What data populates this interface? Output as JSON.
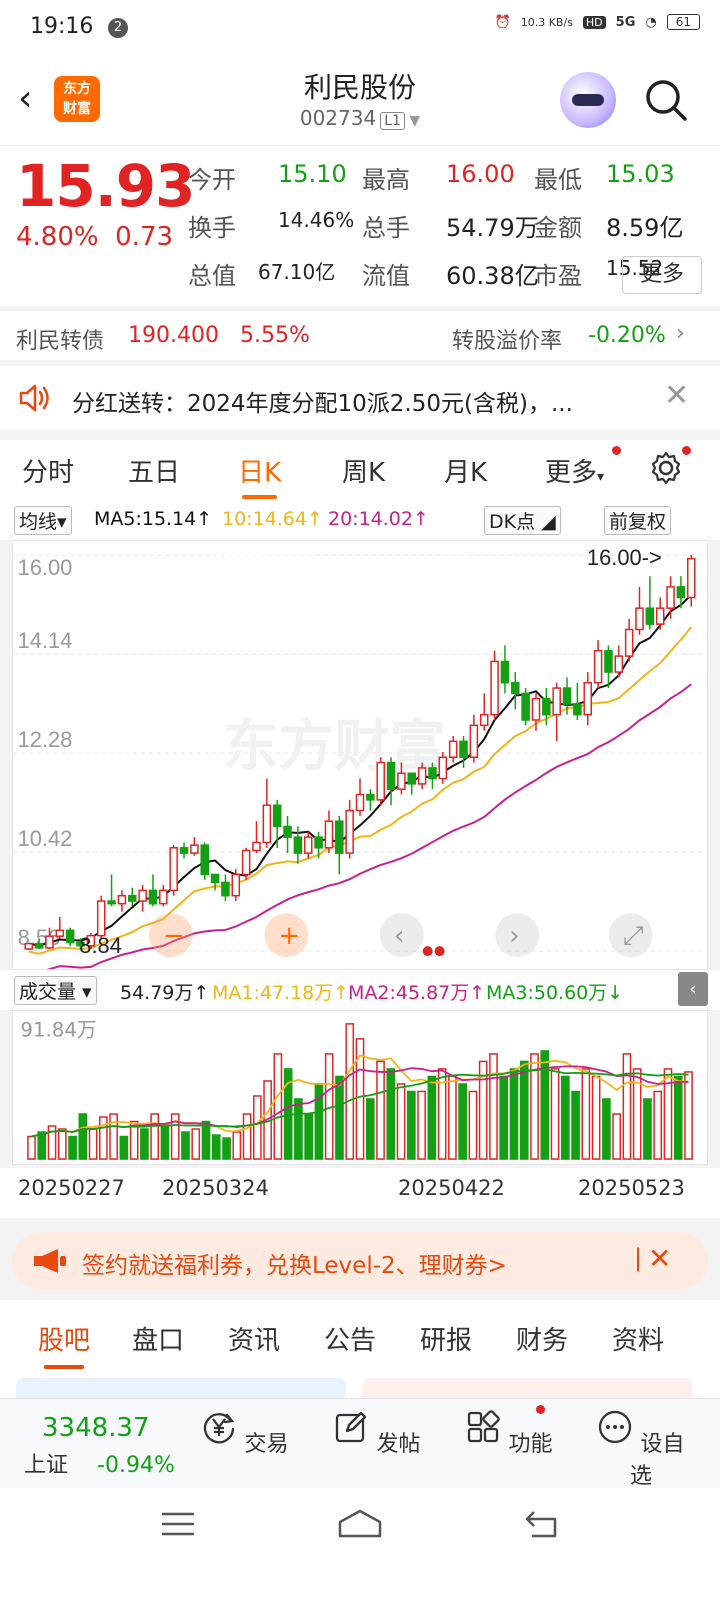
{
  "status": {
    "time": "19:16",
    "badge": "2",
    "net": "10.3 KB/s",
    "hd": "HD",
    "signal": "5G",
    "battery": "61"
  },
  "header": {
    "title": "利民股份",
    "code": "002734",
    "level": "L1",
    "logo": "东方财富"
  },
  "quote": {
    "price": "15.93",
    "pct": "4.80%",
    "change": "0.73",
    "rows": [
      [
        {
          "label": "今开",
          "value": "15.10",
          "color": "green"
        },
        {
          "label": "最高",
          "value": "16.00",
          "color": "red"
        },
        {
          "label": "最低",
          "value": "15.03",
          "color": "green"
        }
      ],
      [
        {
          "label": "换手",
          "value": "14.46%",
          "color": "dark"
        },
        {
          "label": "总手",
          "value": "54.79万",
          "color": "dark"
        },
        {
          "label": "金额",
          "value": "8.59亿",
          "color": "dark"
        }
      ],
      [
        {
          "label": "总值",
          "value": "67.10亿",
          "color": "dark"
        },
        {
          "label": "流值",
          "value": "60.38亿",
          "color": "dark"
        },
        {
          "label": "市盈",
          "value": "15.52",
          "color": "dark"
        }
      ]
    ],
    "more": "更多"
  },
  "cbond": {
    "name": "利民转债",
    "price": "190.400",
    "pct": "5.55%",
    "premium_label": "转股溢价率",
    "premium": "-0.20%"
  },
  "notice": {
    "text": "分红送转：2024年度分配10派2.50元(含税)，..."
  },
  "chart_tabs": [
    "分时",
    "五日",
    "日K",
    "周K",
    "月K",
    "更多"
  ],
  "ma_bar": {
    "select": "均线",
    "ma5": "MA5:15.14",
    "ma10": "10:14.64",
    "ma20": "20:14.02",
    "dk": "DK点",
    "adjust": "前复权"
  },
  "vol_bar": {
    "select": "成交量",
    "vol": "54.79万",
    "ma1": "MA1:47.18万",
    "ma2": "MA2:45.87万",
    "ma3": "MA3:50.60万"
  },
  "colors": {
    "up": "#e02424",
    "down": "#14a014",
    "ma5": "#111111",
    "ma10": "#f2b418",
    "ma20": "#c8208c",
    "accent": "#ff6a00"
  },
  "chart_data": {
    "type": "candlestick",
    "y_ticks": [
      "16.00",
      "14.14",
      "12.28",
      "10.42",
      "8.56"
    ],
    "ylim": [
      8.56,
      16.0
    ],
    "high_label": "16.00->",
    "low_label": "8.84",
    "candles": [
      [
        8.6,
        8.7,
        8.7,
        8.58
      ],
      [
        8.7,
        8.62,
        8.8,
        8.6
      ],
      [
        8.62,
        8.84,
        9.0,
        8.6
      ],
      [
        8.84,
        8.95,
        9.2,
        8.8
      ],
      [
        8.95,
        8.72,
        9.0,
        8.65
      ],
      [
        8.72,
        8.66,
        8.8,
        8.6
      ],
      [
        8.66,
        8.85,
        8.9,
        8.6
      ],
      [
        8.85,
        9.5,
        9.6,
        8.8
      ],
      [
        9.5,
        9.45,
        10.0,
        9.4
      ],
      [
        9.45,
        9.6,
        9.7,
        9.3
      ],
      [
        9.6,
        9.5,
        9.75,
        9.4
      ],
      [
        9.5,
        9.7,
        9.8,
        9.3
      ],
      [
        9.7,
        9.45,
        10.0,
        9.4
      ],
      [
        9.45,
        9.7,
        9.8,
        9.4
      ],
      [
        9.7,
        10.5,
        10.55,
        9.6
      ],
      [
        10.5,
        10.4,
        10.6,
        10.3
      ],
      [
        10.4,
        10.55,
        10.7,
        10.35
      ],
      [
        10.55,
        10.0,
        10.6,
        9.9
      ],
      [
        10.0,
        9.85,
        10.0,
        9.7
      ],
      [
        9.85,
        9.6,
        10.0,
        9.5
      ],
      [
        9.6,
        10.0,
        10.1,
        9.5
      ],
      [
        10.0,
        10.45,
        10.5,
        9.9
      ],
      [
        10.45,
        10.6,
        11.0,
        10.4
      ],
      [
        10.6,
        11.3,
        11.8,
        10.5
      ],
      [
        11.3,
        10.9,
        11.4,
        10.5
      ],
      [
        10.9,
        10.7,
        11.1,
        10.4
      ],
      [
        10.7,
        10.4,
        10.9,
        10.2
      ],
      [
        10.4,
        10.7,
        10.8,
        10.3
      ],
      [
        10.7,
        10.5,
        10.8,
        10.3
      ],
      [
        10.5,
        11.0,
        11.2,
        10.4
      ],
      [
        11.0,
        10.4,
        11.1,
        10.0
      ],
      [
        10.4,
        11.2,
        11.4,
        10.3
      ],
      [
        11.2,
        11.5,
        11.8,
        11.1
      ],
      [
        11.5,
        11.4,
        11.6,
        11.2
      ],
      [
        11.4,
        12.1,
        12.2,
        11.3
      ],
      [
        12.1,
        11.6,
        12.2,
        11.3
      ],
      [
        11.6,
        11.9,
        12.1,
        11.5
      ],
      [
        11.9,
        11.7,
        11.9,
        11.5
      ],
      [
        11.7,
        12.0,
        12.1,
        11.6
      ],
      [
        12.0,
        11.8,
        12.1,
        11.6
      ],
      [
        11.8,
        12.2,
        12.3,
        11.7
      ],
      [
        12.2,
        12.5,
        12.6,
        12.1
      ],
      [
        12.5,
        12.2,
        12.6,
        12.0
      ],
      [
        12.2,
        12.8,
        13.0,
        12.1
      ],
      [
        12.8,
        13.0,
        13.4,
        12.7
      ],
      [
        13.0,
        14.0,
        14.2,
        12.9
      ],
      [
        14.0,
        13.6,
        14.3,
        13.4
      ],
      [
        13.6,
        13.4,
        13.8,
        13.1
      ],
      [
        13.4,
        12.9,
        13.5,
        12.8
      ],
      [
        12.9,
        13.3,
        13.4,
        12.7
      ],
      [
        13.3,
        13.0,
        13.5,
        12.8
      ],
      [
        13.0,
        13.5,
        13.6,
        12.5
      ],
      [
        13.5,
        13.2,
        13.7,
        13.0
      ],
      [
        13.2,
        13.0,
        13.6,
        12.9
      ],
      [
        13.0,
        13.6,
        13.8,
        12.8
      ],
      [
        13.6,
        14.2,
        14.4,
        13.5
      ],
      [
        14.2,
        13.8,
        14.3,
        13.5
      ],
      [
        13.8,
        14.1,
        14.3,
        13.7
      ],
      [
        14.1,
        14.6,
        14.8,
        14.0
      ],
      [
        14.6,
        15.0,
        15.4,
        14.5
      ],
      [
        15.0,
        14.7,
        15.6,
        14.6
      ],
      [
        14.7,
        15.0,
        15.2,
        14.6
      ],
      [
        15.0,
        15.4,
        15.6,
        14.8
      ],
      [
        15.4,
        15.2,
        15.6,
        15.0
      ],
      [
        15.2,
        15.93,
        16.0,
        15.03
      ]
    ],
    "volume": {
      "max_label": "91.84万",
      "values": [
        15,
        18,
        22,
        20,
        15,
        30,
        20,
        28,
        30,
        15,
        25,
        20,
        30,
        22,
        30,
        18,
        20,
        25,
        16,
        14,
        18,
        30,
        42,
        52,
        70,
        60,
        40,
        30,
        50,
        70,
        55,
        90,
        80,
        40,
        65,
        60,
        50,
        45,
        45,
        55,
        60,
        55,
        50,
        45,
        65,
        70,
        55,
        60,
        65,
        70,
        72,
        60,
        55,
        45,
        60,
        55,
        40,
        30,
        70,
        60,
        40,
        45,
        60,
        55,
        58
      ],
      "down": [
        false,
        true,
        false,
        false,
        true,
        true,
        false,
        false,
        false,
        true,
        false,
        true,
        false,
        true,
        false,
        true,
        false,
        true,
        true,
        true,
        false,
        false,
        false,
        false,
        false,
        true,
        true,
        true,
        true,
        false,
        true,
        false,
        false,
        true,
        false,
        true,
        false,
        true,
        false,
        true,
        false,
        false,
        true,
        false,
        false,
        false,
        true,
        true,
        true,
        false,
        true,
        false,
        true,
        true,
        false,
        false,
        true,
        false,
        false,
        false,
        true,
        false,
        false,
        true,
        false
      ],
      "xlabels": [
        "20250227",
        "20250324",
        "20250422",
        "20250523"
      ]
    }
  },
  "ad": {
    "text": "签约就送福利券，兑换Level-2、理财券>"
  },
  "bottom_tabs": [
    "股吧",
    "盘口",
    "资讯",
    "公告",
    "研报",
    "财务",
    "资料"
  ],
  "toolbar": {
    "index_value": "3348.37",
    "index_name": "上证",
    "index_pct": "-0.94%",
    "items": [
      "交易",
      "发帖",
      "功能",
      "设自选"
    ]
  }
}
